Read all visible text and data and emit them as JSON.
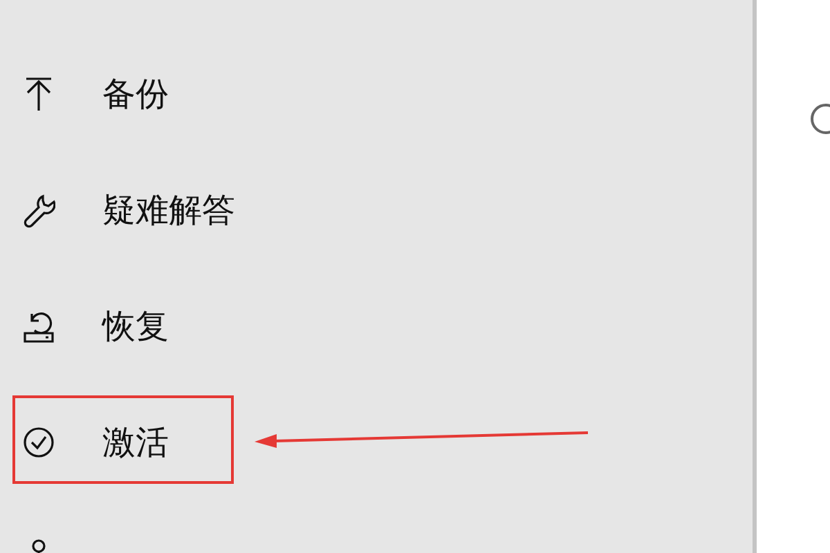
{
  "sidebar": {
    "items": [
      {
        "label": "备份"
      },
      {
        "label": "疑难解答"
      },
      {
        "label": "恢复"
      },
      {
        "label": "激活",
        "highlighted": true
      }
    ]
  }
}
